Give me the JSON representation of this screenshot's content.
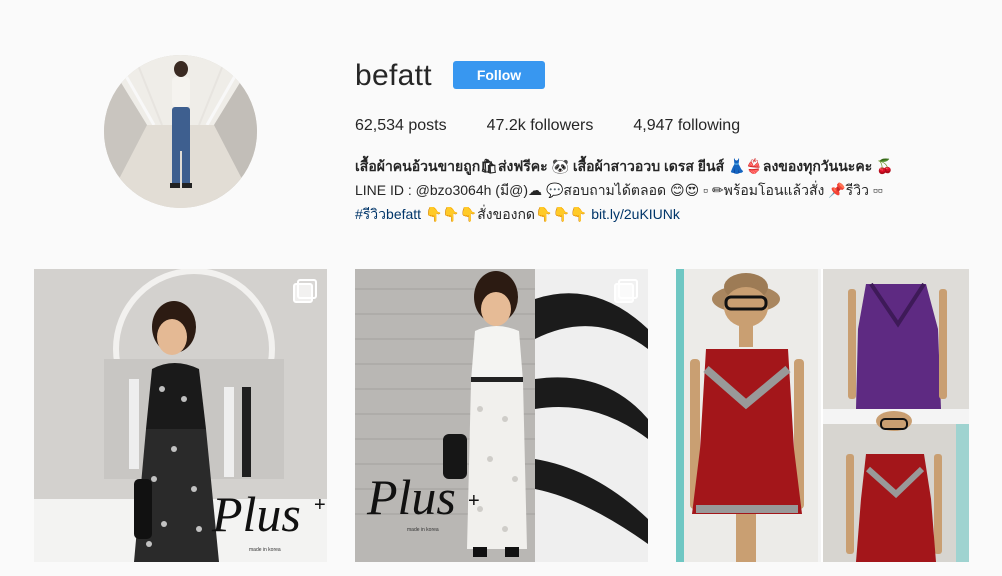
{
  "profile": {
    "username": "befatt",
    "follow_label": "Follow",
    "avatar_alt": "profile-photo"
  },
  "stats": {
    "posts_num": "62,534",
    "posts_label": " posts",
    "followers_num": "47.2k",
    "followers_label": " followers",
    "following_num": "4,947",
    "following_label": " following"
  },
  "bio": {
    "full_name": "เสื้อผ้าคนอ้วนขายถูก🛍ส่งฟรีคะ 🐼 เสื้อผ้าสาวอวบ เดรส ยีนส์ 👗👙ลงของทุกวันนะคะ 🍒",
    "line2": "LINE ID : @bzo3064h (มี@)☁ 💬สอบถามได้ตลอด 😊😍 ▫ ✏พร้อมโอนแล้วสั่ง 📌รีวิว ▫▫",
    "hashtag": "#รีวิวbefatt",
    "line3_text": " 👇👇👇สั่งของกด👇👇👇 ",
    "link": "bit.ly/2uKIUNk"
  },
  "posts": [
    {
      "label": "post-1",
      "multi": true
    },
    {
      "label": "post-2",
      "multi": true
    },
    {
      "label": "post-3",
      "multi": false
    }
  ],
  "photo_text": {
    "brand": "Plus",
    "plus_sign": "+",
    "made_in": "made in korea"
  },
  "colors": {
    "accent": "#3897f0",
    "background": "#fafafa",
    "text": "#262626",
    "link": "#003569"
  }
}
